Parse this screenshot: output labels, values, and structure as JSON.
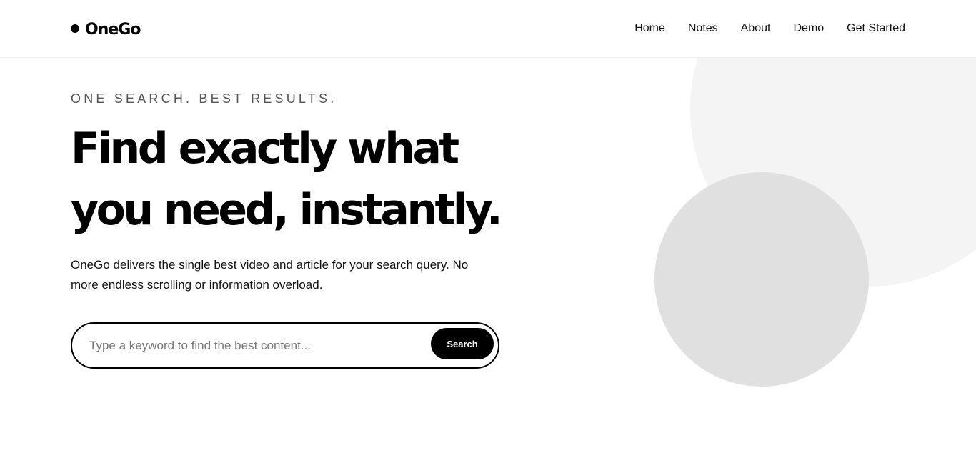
{
  "header": {
    "logo_text": "OneGo",
    "nav": [
      "Home",
      "Notes",
      "About",
      "Demo",
      "Get Started"
    ]
  },
  "hero": {
    "tagline": "ONE SEARCH. BEST RESULTS.",
    "headline_line1": "Find exactly what",
    "headline_line2": "you need, instantly.",
    "description": "OneGo delivers the single best video and article for your search query. No more endless scrolling or information overload."
  },
  "search": {
    "placeholder": "Type a keyword to find the best content...",
    "value": "",
    "button_label": "Search"
  },
  "colors": {
    "accent": "#000000",
    "circle_light": "#f4f4f4",
    "circle_mid": "#e0e0e0"
  }
}
